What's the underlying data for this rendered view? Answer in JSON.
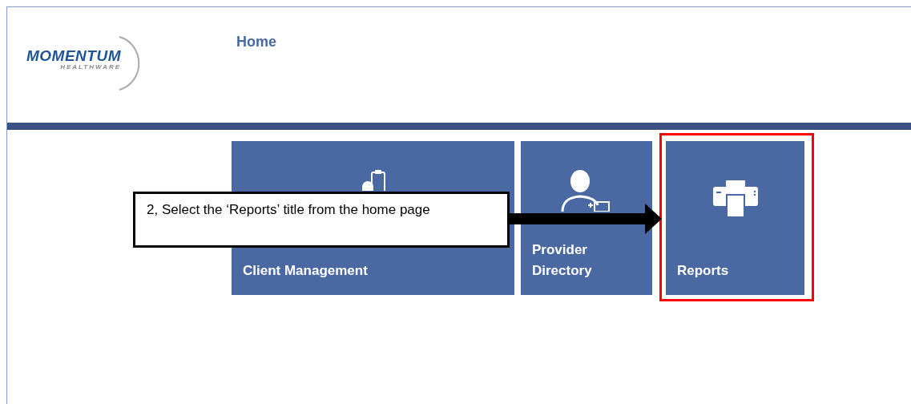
{
  "header": {
    "logo": {
      "name": "MOMENTUM",
      "tagline": "HEALTHWARE"
    },
    "title": "Home"
  },
  "tiles": [
    {
      "kind": "clients",
      "label": "Client Management",
      "highlighted": false
    },
    {
      "kind": "providers",
      "label": "Provider Directory",
      "highlighted": false
    },
    {
      "kind": "reports",
      "label": "Reports",
      "highlighted": true
    }
  ],
  "callout": {
    "text": "2, Select the ‘Reports’ title from the home page"
  }
}
